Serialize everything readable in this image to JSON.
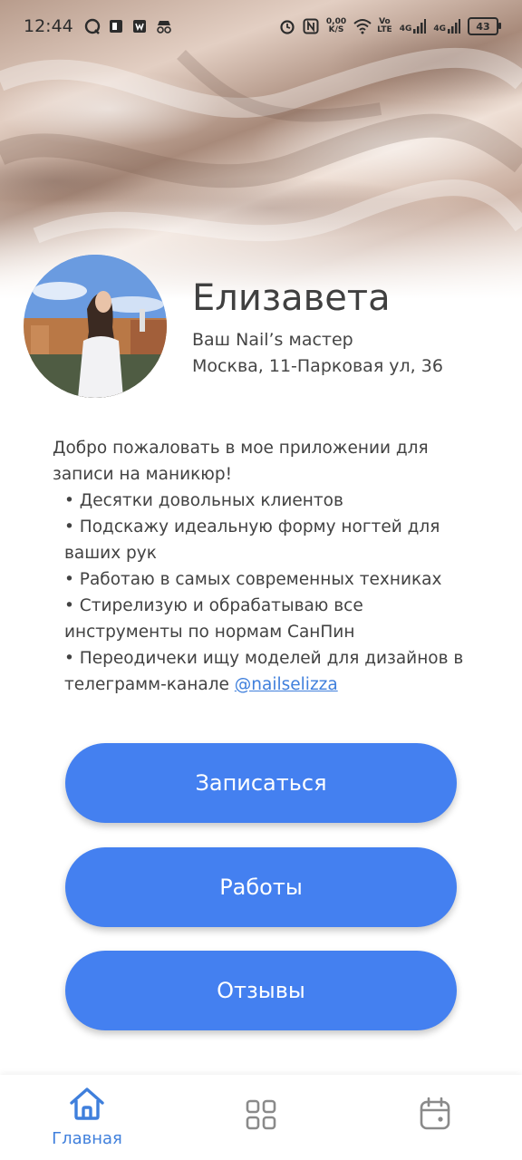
{
  "status_bar": {
    "time": "12:44",
    "net_speed_value": "0,00",
    "net_speed_unit": "K/S",
    "volte_top": "Vo",
    "volte_bottom": "LTE",
    "signal1": "4G",
    "signal2": "4G",
    "battery": "43"
  },
  "profile": {
    "name": "Елизавета",
    "subtitle": "Ваш Nail’s мастер",
    "address": "Москва, 11-Парковая ул, 36"
  },
  "description": {
    "intro": "Добро пожаловать в мое приложении для записи на маникюр!",
    "bullets": [
      "Десятки довольных клиентов",
      "Подскажу идеальную форму ногтей для ваших рук",
      "Работаю в самых современных техниках",
      "Стирелизую и обрабатываю все инструменты по нормам СанПин"
    ],
    "last_bullet_text": "Переодичеки ищу моделей для дизайнов в телеграмм-канале ",
    "link": "@nailselizza"
  },
  "buttons": {
    "book": "Записаться",
    "works": "Работы",
    "reviews": "Отзывы"
  },
  "bottom_nav": {
    "home_label": "Главная",
    "active": "home",
    "icons": [
      "home-icon",
      "grid-icon",
      "calendar-icon"
    ]
  },
  "colors": {
    "accent": "#4480f0",
    "link": "#3f7fdc",
    "text": "#424242"
  }
}
